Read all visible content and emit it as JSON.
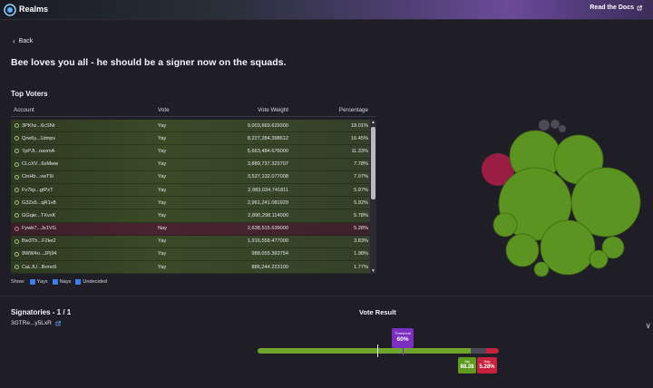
{
  "header": {
    "app_title": "Realms",
    "docs_label": "Read the Docs"
  },
  "nav": {
    "back_label": "Back"
  },
  "proposal": {
    "title": "Bee loves you all - he should be a signer now on the squads."
  },
  "top_voters": {
    "section_title": "Top Voters",
    "columns": {
      "account": "Account",
      "vote": "Vote",
      "weight": "Vote Weight",
      "percentage": "Percentage"
    },
    "rows": [
      {
        "account": "3PKhz...6cSNt",
        "vote": "Yay",
        "weight": "9,003,669.629300",
        "pct": "18.01%"
      },
      {
        "account": "Qrw6y...1dmpv",
        "vote": "Yay",
        "weight": "8,227,284.398612",
        "pct": "16.45%"
      },
      {
        "account": "7pPJt...oaxmA",
        "vote": "Yay",
        "weight": "5,663,484.676000",
        "pct": "11.33%"
      },
      {
        "account": "CLcXV...6sMww",
        "vote": "Yay",
        "weight": "3,889,737.323707",
        "pct": "7.78%"
      },
      {
        "account": "CinHb...vwT9i",
        "vote": "Yay",
        "weight": "3,537,132.077008",
        "pct": "7.07%"
      },
      {
        "account": "Fv7kp...gtPzT",
        "vote": "Yay",
        "weight": "2,983,034.741811",
        "pct": "5.97%"
      },
      {
        "account": "G3Zx5...qR1v8",
        "vote": "Yay",
        "weight": "2,961,241.081929",
        "pct": "5.92%"
      },
      {
        "account": "GGqie...TXvxK",
        "vote": "Yay",
        "weight": "2,890,298.114000",
        "pct": "5.78%"
      },
      {
        "account": "Fywb7...Js1VG",
        "vote": "Nay",
        "weight": "2,638,515.639000",
        "pct": "5.28%"
      },
      {
        "account": "Bw3Th...F2ke2",
        "vote": "Yay",
        "weight": "1,916,558.477000",
        "pct": "3.83%"
      },
      {
        "account": "9WW4o...JPj94",
        "vote": "Yay",
        "weight": "988,055.393754",
        "pct": "1.98%"
      },
      {
        "account": "CaLJU...Brmo9",
        "vote": "Yay",
        "weight": "886,244.223100",
        "pct": "1.77%"
      }
    ],
    "filters": {
      "show_label": "Show:",
      "yays": "Yays",
      "nays": "Nays",
      "undecided": "Undecided"
    }
  },
  "signatories": {
    "title": "Signatories - 1 / 1",
    "address": "3GTRe...y5LxR"
  },
  "vote_result": {
    "title": "Vote Result",
    "threshold_label": "Threshold",
    "threshold_value": "60%",
    "threshold_fraction": 0.6,
    "yay_label": "Yay",
    "yay_value": "88.28",
    "yay_fraction": 0.8828,
    "nay_label": "Nay",
    "nay_value": "5.28%",
    "nay_fraction": 0.0528
  },
  "colors": {
    "yay": "#6fa52a",
    "nay": "#c7213f",
    "threshold": "#7b2fbf",
    "undecided": "#6e6e78",
    "filter_checkbox": "#3a7ef0"
  }
}
